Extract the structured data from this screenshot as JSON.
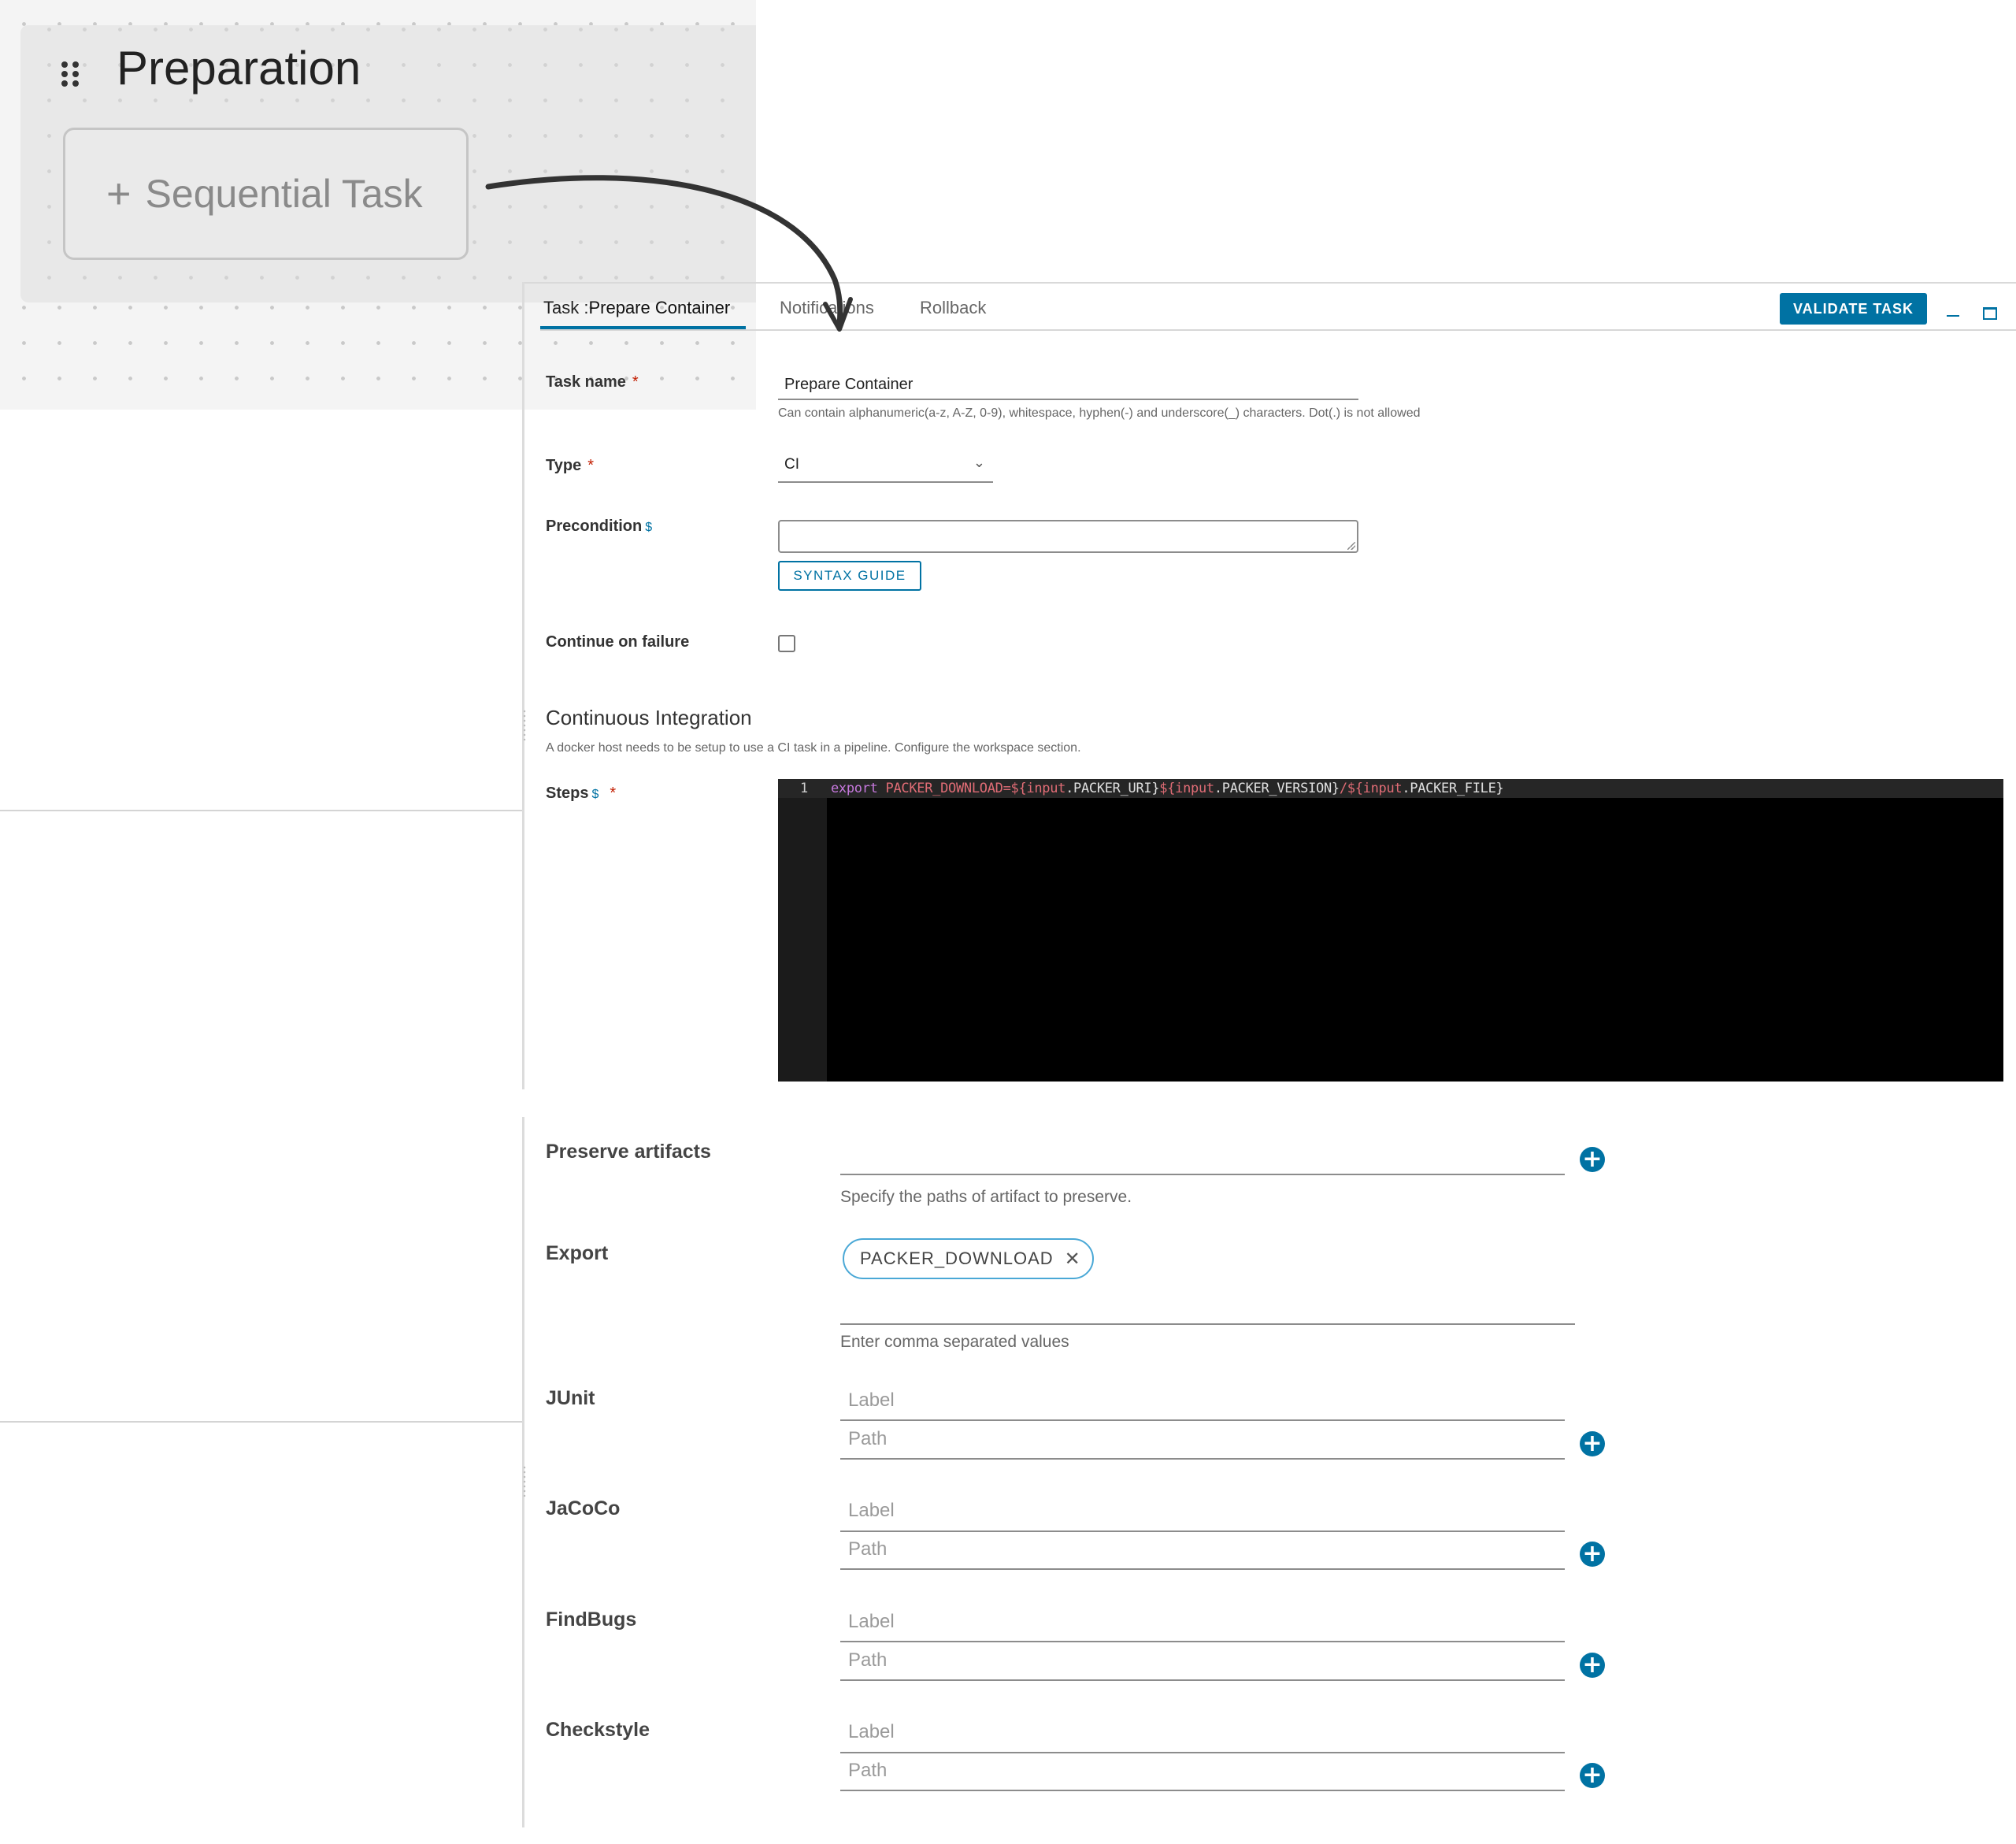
{
  "stage": {
    "title": "Preparation",
    "sequential_task_label": "Sequential Task",
    "plus_symbol": "+"
  },
  "tabs": {
    "task_prefix": "Task :",
    "task_name": "Prepare Container",
    "notifications": "Notifications",
    "rollback": "Rollback"
  },
  "toolbar": {
    "validate_label": "VALIDATE TASK"
  },
  "form": {
    "task_name_label": "Task name",
    "task_name_value": "Prepare Container",
    "task_name_help": "Can contain alphanumeric(a-z, A-Z, 0-9), whitespace, hyphen(-) and underscore(_) characters. Dot(.) is not allowed",
    "type_label": "Type",
    "type_value": "CI",
    "precondition_label": "Precondition",
    "syntax_guide_label": "SYNTAX GUIDE",
    "continue_on_failure_label": "Continue on failure",
    "continue_on_failure_checked": false,
    "required_mark": "*",
    "dollar_mark": "$"
  },
  "ci": {
    "title": "Continuous Integration",
    "help": "A docker host needs to be setup to use a CI task in a pipeline. Configure the workspace section.",
    "steps_label": "Steps",
    "line_number": "1",
    "code": {
      "kw_export": "export",
      "var_name": "PACKER_DOWNLOAD",
      "eq_open": "=${",
      "input1": "input",
      "p1": ".PACKER_URI}",
      "open2": "${",
      "input2": "input",
      "p2": ".PACKER_VERSION}",
      "slash_open3": "/${",
      "input3": "input",
      "p3": ".PACKER_FILE}"
    }
  },
  "artifacts": {
    "preserve_label": "Preserve artifacts",
    "preserve_help": "Specify the paths of artifact to preserve.",
    "export_label": "Export",
    "export_chip": "PACKER_DOWNLOAD",
    "export_help": "Enter comma separated values",
    "label_placeholder": "Label",
    "path_placeholder": "Path",
    "junit_label": "JUnit",
    "jacoco_label": "JaCoCo",
    "findbugs_label": "FindBugs",
    "checkstyle_label": "Checkstyle"
  },
  "colors": {
    "accent": "#0072a3",
    "required": "#c21d00",
    "editor_bg": "#000000"
  },
  "icons": {
    "grip": "drag-handle-icon",
    "add": "plus-circle-icon",
    "chevron": "chevron-down-icon",
    "close": "close-icon",
    "minimize": "minimize-icon",
    "maximize": "maximize-icon"
  }
}
